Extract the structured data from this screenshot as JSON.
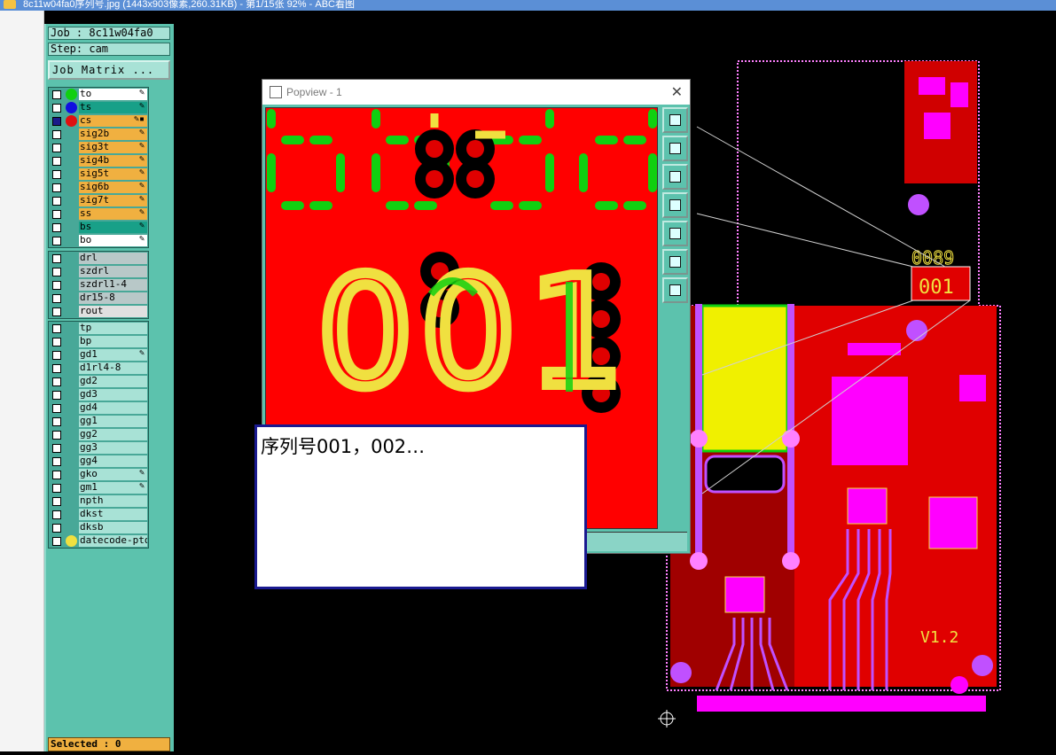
{
  "window": {
    "title": "8c11w04fa0序列号.jpg (1443x903像素,260.31KB) - 第1/15张 92% - ABC看图"
  },
  "panel": {
    "job": "Job : 8c11w04fa0",
    "step": "Step: cam",
    "job_matrix_label": "Job Matrix ...",
    "selected": "Selected : 0"
  },
  "layers_group1": [
    {
      "name": "to",
      "bg": "#ffffff",
      "dot": "#10d010",
      "flag": "✎",
      "checked": false
    },
    {
      "name": "ts",
      "bg": "#18a088",
      "dot": "#1010e0",
      "flag": "✎",
      "checked": false
    },
    {
      "name": "cs",
      "bg": "#f0b040",
      "dot": "#e01010",
      "flag": "✎▪",
      "checked": true
    },
    {
      "name": "sig2b",
      "bg": "#f0b040",
      "dot": "",
      "flag": "✎",
      "checked": false
    },
    {
      "name": "sig3t",
      "bg": "#f0b040",
      "dot": "",
      "flag": "✎",
      "checked": false
    },
    {
      "name": "sig4b",
      "bg": "#f0b040",
      "dot": "",
      "flag": "✎",
      "checked": false
    },
    {
      "name": "sig5t",
      "bg": "#f0b040",
      "dot": "",
      "flag": "✎",
      "checked": false
    },
    {
      "name": "sig6b",
      "bg": "#f0b040",
      "dot": "",
      "flag": "✎",
      "checked": false
    },
    {
      "name": "sig7t",
      "bg": "#f0b040",
      "dot": "",
      "flag": "✎",
      "checked": false
    },
    {
      "name": "ss",
      "bg": "#f0b040",
      "dot": "",
      "flag": "✎",
      "checked": false
    },
    {
      "name": "bs",
      "bg": "#18a088",
      "dot": "",
      "flag": "✎",
      "checked": false
    },
    {
      "name": "bo",
      "bg": "#ffffff",
      "dot": "",
      "flag": "✎",
      "checked": false
    }
  ],
  "layers_group2": [
    {
      "name": "drl",
      "bg": "#b8c8c8",
      "dot": "",
      "flag": "",
      "checked": false
    },
    {
      "name": "szdrl",
      "bg": "#b8c8c8",
      "dot": "",
      "flag": "",
      "checked": false
    },
    {
      "name": "szdrl1-4",
      "bg": "#b8c8c8",
      "dot": "",
      "flag": "",
      "checked": false
    },
    {
      "name": "dr15-8",
      "bg": "#b8c8c8",
      "dot": "",
      "flag": "",
      "checked": false
    },
    {
      "name": "rout",
      "bg": "#e0e0e0",
      "dot": "",
      "flag": "",
      "checked": false
    }
  ],
  "layers_group3": [
    {
      "name": "tp",
      "bg": "#a8e2d6",
      "dot": "",
      "flag": "",
      "checked": false
    },
    {
      "name": "bp",
      "bg": "#a8e2d6",
      "dot": "",
      "flag": "",
      "checked": false
    },
    {
      "name": "gd1",
      "bg": "#a8e2d6",
      "dot": "",
      "flag": "✎",
      "checked": false
    },
    {
      "name": "d1rl4-8",
      "bg": "#a8e2d6",
      "dot": "",
      "flag": "",
      "checked": false
    },
    {
      "name": "gd2",
      "bg": "#a8e2d6",
      "dot": "",
      "flag": "",
      "checked": false
    },
    {
      "name": "gd3",
      "bg": "#a8e2d6",
      "dot": "",
      "flag": "",
      "checked": false
    },
    {
      "name": "gd4",
      "bg": "#a8e2d6",
      "dot": "",
      "flag": "",
      "checked": false
    },
    {
      "name": "gg1",
      "bg": "#a8e2d6",
      "dot": "",
      "flag": "",
      "checked": false
    },
    {
      "name": "gg2",
      "bg": "#a8e2d6",
      "dot": "",
      "flag": "",
      "checked": false
    },
    {
      "name": "gg3",
      "bg": "#a8e2d6",
      "dot": "",
      "flag": "",
      "checked": false
    },
    {
      "name": "gg4",
      "bg": "#a8e2d6",
      "dot": "",
      "flag": "",
      "checked": false
    },
    {
      "name": "gko",
      "bg": "#a8e2d6",
      "dot": "",
      "flag": "✎",
      "checked": false
    },
    {
      "name": "gm1",
      "bg": "#a8e2d6",
      "dot": "",
      "flag": "✎",
      "checked": false
    },
    {
      "name": "npth",
      "bg": "#a8e2d6",
      "dot": "",
      "flag": "",
      "checked": false
    },
    {
      "name": "dkst",
      "bg": "#a8e2d6",
      "dot": "",
      "flag": "",
      "checked": false
    },
    {
      "name": "dksb",
      "bg": "#a8e2d6",
      "dot": "",
      "flag": "",
      "checked": false
    },
    {
      "name": "datecode-pto",
      "bg": "#a8e2d6",
      "dot": "#f0e040",
      "flag": "",
      "checked": false
    }
  ],
  "popview": {
    "title": "Popview - 1",
    "close_glyph": "✕",
    "serial_digits": [
      "0",
      "0",
      "1"
    ],
    "toolbar_icons": [
      "zoom-window-icon",
      "page-up-icon",
      "page-down-icon",
      "pan-left-icon",
      "pan-right-icon",
      "fit-all-icon",
      "zoom-center-icon"
    ]
  },
  "note_text": "序列号001，002…",
  "board": {
    "serial_label": "001",
    "version_label": "V1.2",
    "colors": {
      "copper": "#f00000",
      "pad": "#ff00ff",
      "silk": "#f0e040",
      "mask": "#10d010",
      "trace": "#c050ff"
    }
  }
}
